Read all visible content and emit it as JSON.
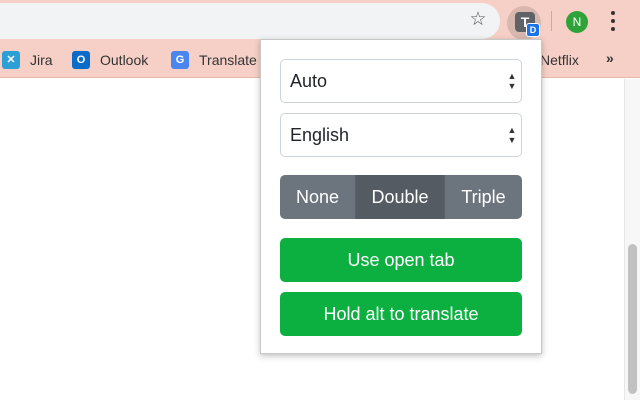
{
  "bookmarks": [
    {
      "label": "Jira",
      "icon": "jira-icon"
    },
    {
      "label": "Outlook",
      "icon": "outlook-icon"
    },
    {
      "label": "Translate",
      "icon": "google-translate-icon"
    },
    {
      "label": "Netflix",
      "icon": "netflix-icon"
    }
  ],
  "toolbar": {
    "star_icon": "star-icon",
    "extension": {
      "letter": "T",
      "badge": "D"
    },
    "avatar_initial": "N",
    "more_icon": "more-vert-icon",
    "overflow_glyph": "»"
  },
  "popup": {
    "source_language": {
      "selected": "Auto"
    },
    "target_language": {
      "selected": "English"
    },
    "click_mode": {
      "options": [
        "None",
        "Double",
        "Triple"
      ],
      "selected": "Double"
    },
    "use_open_tab_label": "Use open tab",
    "hold_alt_label": "Hold alt to translate"
  },
  "colors": {
    "chrome_background": "#f6d0c6",
    "primary_button": "#0cb041",
    "segment": "#6c757d",
    "segment_active": "#545b62"
  }
}
